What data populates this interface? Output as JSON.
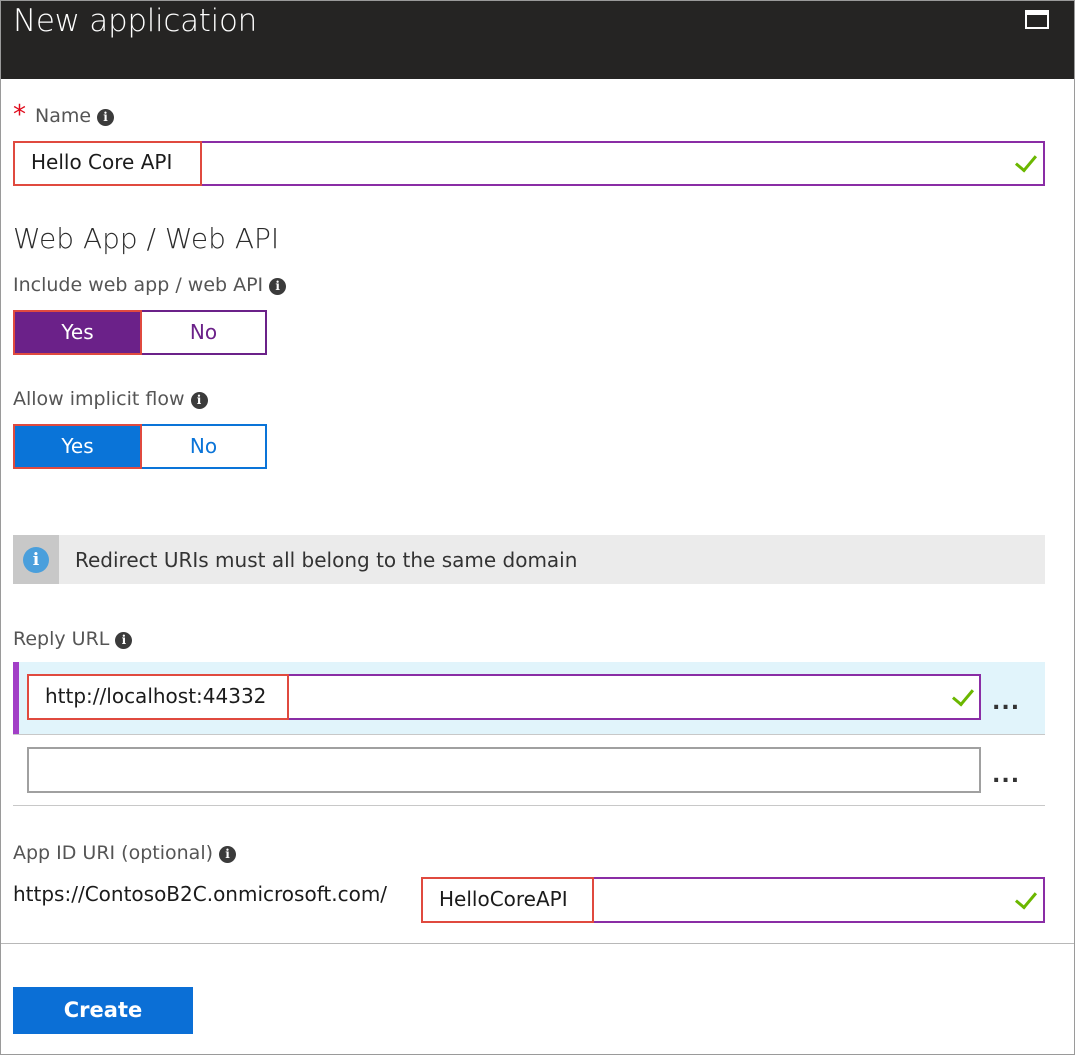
{
  "window": {
    "title": "New application"
  },
  "name_field": {
    "required_mark": "*",
    "label": "Name",
    "value": "Hello Core API"
  },
  "section": {
    "title": "Web App / Web API"
  },
  "include_web_app": {
    "label": "Include web app / web API",
    "options": [
      "Yes",
      "No"
    ],
    "selected": "Yes",
    "accent": "#6b2189"
  },
  "implicit_flow": {
    "label": "Allow implicit flow",
    "options": [
      "Yes",
      "No"
    ],
    "selected": "Yes",
    "accent": "#0a74d8"
  },
  "info_banner": {
    "text": "Redirect URIs must all belong to the same domain"
  },
  "reply_url": {
    "label": "Reply URL",
    "entries": [
      "http://localhost:44332",
      ""
    ],
    "more_label": "..."
  },
  "app_id_uri": {
    "label": "App ID URI (optional)",
    "prefix": "https://ContosoB2C.onmicrosoft.com/",
    "value": "HelloCoreAPI"
  },
  "actions": {
    "create_label": "Create"
  },
  "colors": {
    "titlebar": "#252423",
    "field_border_active": "#8a2da5",
    "valid_check": "#6bb700",
    "highlight_box": "#e04a3f",
    "primary_button": "#0b6fd6"
  }
}
